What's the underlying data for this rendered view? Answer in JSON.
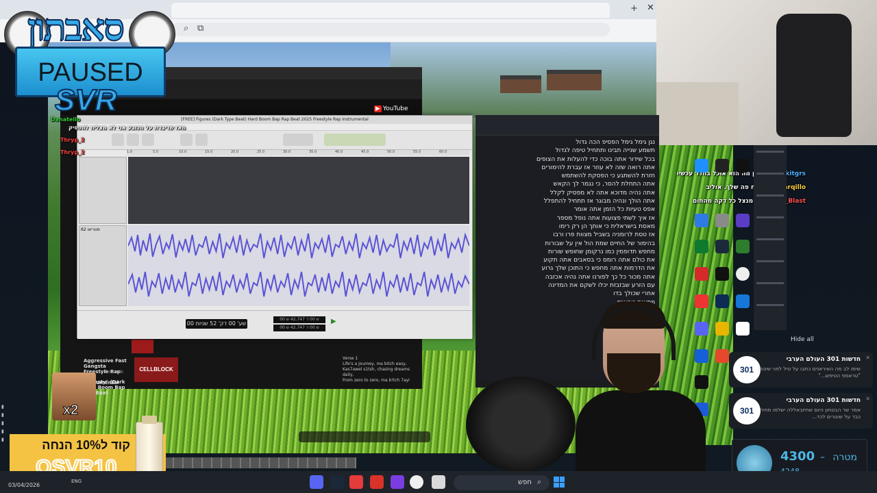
{
  "overlay": {
    "channel_logo_text": "סאבתון",
    "paused_label": "PAUSED",
    "brand_label": "SVR",
    "promo_text": "קוד ל10% הנחה",
    "promo_code": "OSVR10",
    "meme_label": "x2"
  },
  "chat_left": [
    {
      "user": "Danatello",
      "text": ""
    },
    {
      "user": "",
      "text": "מאז שדיברת על הכובע אני לא מצליח להפסיק"
    },
    {
      "user": "Thryp_2",
      "text": ""
    },
    {
      "user": "Thryp_2",
      "text": ""
    }
  ],
  "chat_right": [
    {
      "user": "ykitgrs",
      "text": "?כמה זמן מה הוא אוכל בחדר עכשיו"
    },
    {
      "user": "Tarqillo",
      "text": "אל תפתח פה שלך. אוליב"
    },
    {
      "user": "Kaos_Blast",
      "text": "הוא מנצל כל דקה מהחום"
    }
  ],
  "youtube": {
    "logo": "YouTube",
    "video_title": "[FREE] Figures (Dark Type Beat) Hard Boom Bap Rap Beat 2025 Freestyle Rap Instrumental",
    "side_items": [
      {
        "title": "Aggressive Fast Gangsta Freestyle Rap Beat Instrumental",
        "sub": "Tone Hub"
      },
      {
        "title": "Honesty\" (Dark Type Boom Bap Rap Beat",
        "sub": ""
      }
    ],
    "cellblock_label": "CELLBLOCK",
    "lyrics": [
      "Verse 1",
      "Life's a journey, ma bitch easy,",
      "Kas7awel s1tsh, chasing dreams daily,",
      "From zero to zero, ma b!tch 7ayi"
    ]
  },
  "audio_editor": {
    "title": "sound - Audacity",
    "ruler_ticks": [
      "1.0",
      "5.0",
      "10.0",
      "15.0",
      "20.0",
      "25.0",
      "30.0",
      "35.0",
      "40.0",
      "45.0",
      "50.0",
      "55.0",
      "60.0",
      "1:05"
    ],
    "time_display": "00 שע' 00 דק' 52 שניות",
    "selection_start": "00 ש 00 ד 42.747 ש",
    "selection_end": "00 ש 00 ד 42.747 ש",
    "track_label": "62 סטריאו"
  },
  "document": {
    "lines": [
      "נגן גימל גימל הפסיפ הכה גדול",
      "תשמע שנייה תבינו ותתחיל טיפה לגדול",
      "בכל שידור אתה בוכה כדי להעלות את הצופים",
      "אתה רואה שזה לא עוזר אז עברת להימורים",
      "חזרת להשתגע כי הפסקת להשתמש",
      "אתה התחלת להסר, כי נגמר לך הקאש",
      "אתה נהיה מדוכא אתה לא מפסיק לקלל",
      "אתה הולך ונהיה מבוגר אז תתחיל להתפלל",
      "אפס טעיות כל הזמן אתה אומר",
      "אז איך לשתי פצועות אתה נופל מספר",
      "מאסת בישראלית כי אותך הן רק רימו",
      "אז טסת לרומניה בשביל מצוות פרו ורבו",
      "בהימור של החיים שמת הול אין על שבורות",
      "מחפש תדופמין כמו נרקומן שחופש שורות",
      "את כולם אתה רומס כי בסאבים אתה תקוע",
      "את הדרמות אתה מחפש כי התוכן שלך גרוע",
      "אתה מכור כל כך לפורנו אתה נהיה אכזבה",
      "עם הזרע שבזבזת יכלו לשקם את המדינה",
      "אחרי שכולך בדו",
      "פתאום טראנס",
      "אבל מי תרצ",
      "אתה מזמ",
      "יש לך",
      "גם הגו",
      "היטלר",
      "אבל זו",
      "יוחד"
    ]
  },
  "notifications": {
    "hide_all": "Hide all",
    "items": [
      {
        "logo": "301",
        "title": "חדשות 301 העולם הערבי",
        "body": "שימו לב מה האיראנים כתבו על טיל לפני שיגור: \"טראמפ הטיפש...\""
      },
      {
        "logo": "301",
        "title": "חדשות 301 העולם הערבי",
        "body": "אמר שר הבטחון היום שחיזבאללה ישלמו מחיר כבד על שיגורים לכד..."
      }
    ]
  },
  "goal": {
    "label": "מטרה",
    "current": "4300",
    "sub": "4248"
  },
  "taskbar": {
    "date": "03/04/2026",
    "lang": "ENG",
    "search_placeholder": "חפש"
  }
}
